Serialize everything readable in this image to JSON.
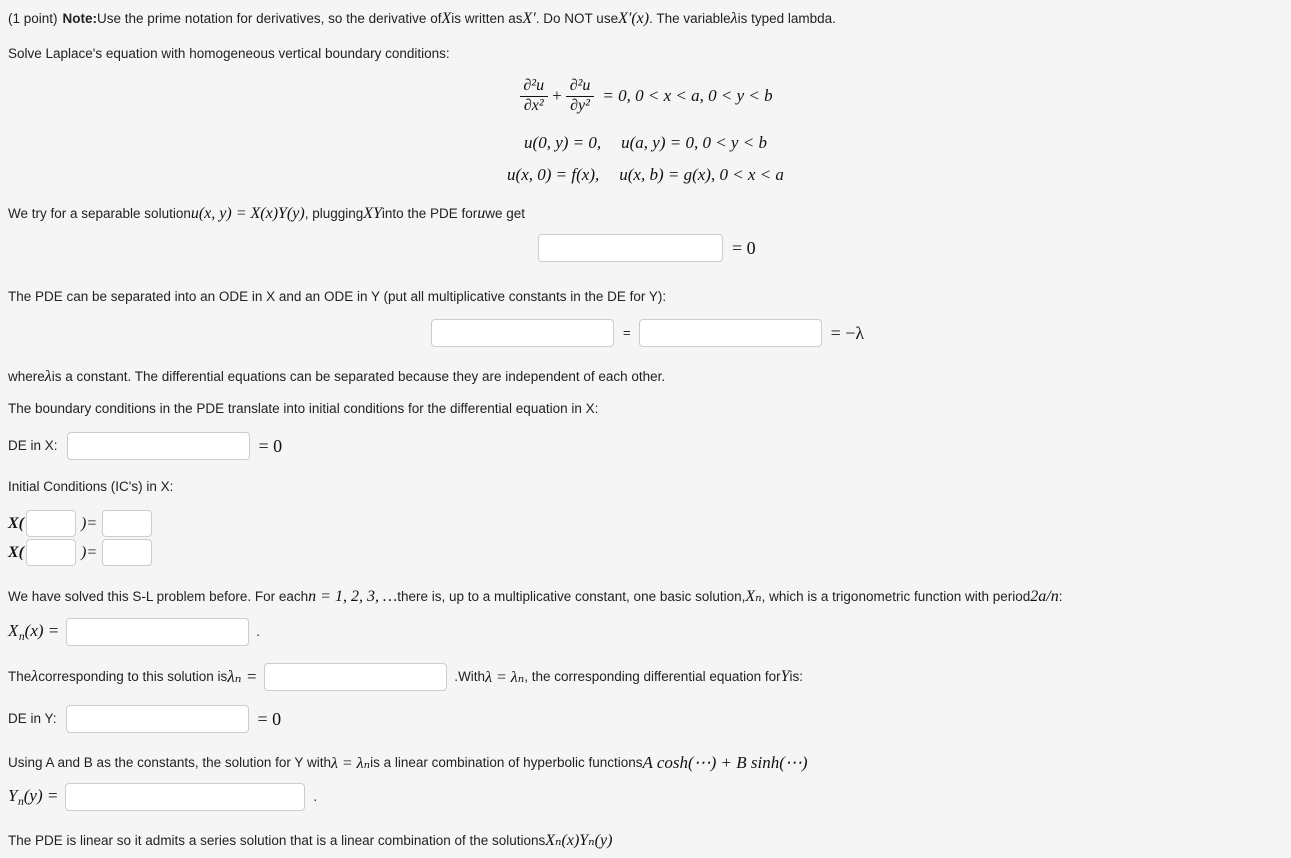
{
  "problem": {
    "points_label": "(1 point)",
    "note_label": "Note:",
    "note_text_1": " Use the prime notation for derivatives, so the derivative of ",
    "note_var_X": "X",
    "note_text_2": " is written as ",
    "note_Xprime": "X′",
    "note_text_3": ". Do NOT use ",
    "note_Xprime_x": "X′(x)",
    "note_text_4": ". The variable ",
    "note_lambda": "λ",
    "note_text_5": " is typed lambda."
  },
  "intro": {
    "solve_line": "Solve Laplace's equation with homogeneous vertical boundary conditions:"
  },
  "pde": {
    "line1": {
      "num1": "∂²u",
      "den1": "∂x²",
      "plus": "+",
      "num2": "∂²u",
      "den2": "∂y²",
      "rest": "= 0, 0 < x < a, 0 < y < b"
    },
    "line2_left": "u(0, y) = 0,",
    "line2_right": "u(a, y) = 0, 0 < y < b",
    "line3_left": "u(x, 0) = f(x),",
    "line3_right": "u(x, b) = g(x), 0 < x < a"
  },
  "separable": {
    "text_1": "We try for a separable solution ",
    "math_1": "u(x, y) = X(x)Y(y)",
    "text_2": ", plugging ",
    "math_2": "XY",
    "text_3": " into the PDE for ",
    "math_3": "u",
    "text_4": " we get",
    "input_value": "",
    "input_placeholder": "",
    "equals_zero": "= 0"
  },
  "separation": {
    "instruction": "The PDE can be separated into an ODE in X and an ODE in Y (put all multiplicative constants in the DE for Y):",
    "left_input_value": "",
    "equals_sign": "=",
    "right_input_value": "",
    "equals_neg_lambda": "= −λ",
    "note_1": "where ",
    "note_lambda": "λ",
    "note_2": " is a constant. The differential equations can be separated because they are independent of each other."
  },
  "bc_section": {
    "intro": "The boundary conditions in the PDE translate into initial conditions for the differential equation in X:",
    "de_in_x_label": "DE in X:",
    "de_in_x_value": "",
    "de_in_x_equals": "= 0",
    "ic_label": "Initial Conditions (IC's) in X:",
    "ic_rows": [
      {
        "fn": "X(",
        "arg_value": "",
        "mid": ")=",
        "rhs_value": ""
      },
      {
        "fn": "X(",
        "arg_value": "",
        "mid": ")=",
        "rhs_value": ""
      }
    ]
  },
  "sl_section": {
    "text_1": "We have solved this S-L problem before. For each ",
    "math_n": "n = 1, 2, 3, …",
    "text_2": " there is, up to a multiplicative constant, one basic solution, ",
    "math_Xn": "Xₙ",
    "text_3": ", which is a trigonometric function with period ",
    "math_period": "2a/n",
    "text_4": ":",
    "xn_label_X": "X",
    "xn_label_sub": "n",
    "xn_label_rest": "(x) =",
    "xn_value": "",
    "period_dot": "."
  },
  "lambda_section": {
    "text_1": "The ",
    "lambda": "λ",
    "text_2": " corresponding to this solution is ",
    "lambda_n": "λₙ =",
    "input_value": "",
    "dot": ".",
    "text_3": " With ",
    "math_lambda_eq": "λ = λₙ",
    "text_4": ", the corresponding differential equation for ",
    "math_Y": "Y",
    "text_5": " is:",
    "de_in_y_label": "DE in Y:",
    "de_in_y_value": "",
    "de_in_y_equals": "= 0"
  },
  "y_solution": {
    "text_1": "Using A and B as the constants, the solution for Y with ",
    "math_lambda": "λ = λₙ",
    "text_2": " is a linear combination of hyperbolic functions ",
    "math_combo": "A cosh(⋯) + B sinh(⋯)",
    "yn_label_Y": "Y",
    "yn_label_sub": "n",
    "yn_label_rest": "(y) =",
    "yn_value": "",
    "dot": "."
  },
  "closing": {
    "text_1": "The PDE is linear so it admits a series solution that is a linear combination of the solutions ",
    "math_XnYn": "Xₙ(x)Yₙ(y)"
  },
  "colors": {
    "background": "#f5f5f5",
    "text": "#222222",
    "math": "#111111",
    "input_border": "#cccccc",
    "input_background": "#ffffff"
  }
}
